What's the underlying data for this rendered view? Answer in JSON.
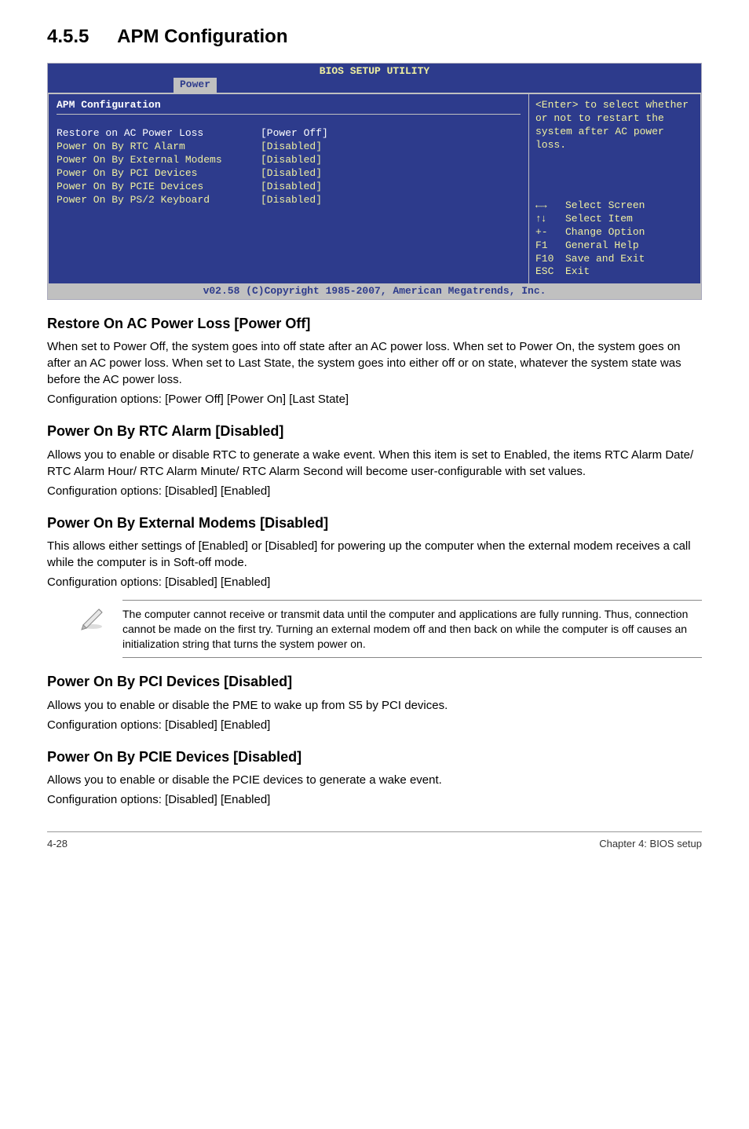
{
  "section": {
    "num": "4.5.5",
    "title": "APM Configuration"
  },
  "bios": {
    "title": "BIOS SETUP UTILITY",
    "tab": "Power",
    "left_header": "APM Configuration",
    "rows": [
      {
        "label": "Restore on AC Power Loss",
        "val": "[Power Off]",
        "selected": true
      },
      {
        "label": "Power On By RTC Alarm",
        "val": "[Disabled]",
        "selected": false
      },
      {
        "label": "Power On By External Modems",
        "val": "[Disabled]",
        "selected": false
      },
      {
        "label": "Power On By PCI Devices",
        "val": "[Disabled]",
        "selected": false
      },
      {
        "label": "Power On By PCIE Devices",
        "val": "[Disabled]",
        "selected": false
      },
      {
        "label": "Power On By PS/2 Keyboard",
        "val": "[Disabled]",
        "selected": false
      }
    ],
    "help_top": "<Enter> to select whether or not to restart the system after AC power loss.",
    "keys": [
      {
        "k": "←→",
        "d": "Select Screen"
      },
      {
        "k": "↑↓",
        "d": "Select Item"
      },
      {
        "k": "+-",
        "d": "Change Option"
      },
      {
        "k": "F1",
        "d": "General Help"
      },
      {
        "k": "F10",
        "d": "Save and Exit"
      },
      {
        "k": "ESC",
        "d": "Exit"
      }
    ],
    "footer": "v02.58 (C)Copyright 1985-2007, American Megatrends, Inc."
  },
  "sections": {
    "restore": {
      "h": "Restore On AC Power Loss [Power Off]",
      "p1": "When set to Power Off, the system goes into off state after an AC power loss. When set to Power On, the system goes on after an AC power loss. When set to Last State, the system goes into either off or on state, whatever the system state was before the AC power loss.",
      "p2": "Configuration options: [Power Off] [Power On] [Last State]"
    },
    "rtc": {
      "h": "Power On By RTC Alarm [Disabled]",
      "p1": "Allows you to enable or disable RTC to generate a wake event. When this item is set to Enabled, the items RTC Alarm Date/ RTC Alarm Hour/ RTC Alarm Minute/ RTC Alarm Second will become user-configurable with set values.",
      "p2": "Configuration options: [Disabled] [Enabled]"
    },
    "ext": {
      "h": "Power On By External Modems [Disabled]",
      "p1": "This allows either settings of [Enabled] or [Disabled] for powering up the computer when the external modem receives a call while the computer is in Soft-off mode.",
      "p2": "Configuration options: [Disabled] [Enabled]"
    },
    "note": "The computer cannot receive or transmit data until the computer and applications are fully running. Thus, connection cannot be made on the first try. Turning an external modem off and then back on while the computer is off causes an initialization string that turns the system power on.",
    "pci": {
      "h": "Power On By PCI Devices [Disabled]",
      "p1": "Allows you to enable or disable the PME to wake up from S5 by PCI devices.",
      "p2": "Configuration options: [Disabled] [Enabled]"
    },
    "pcie": {
      "h": "Power On By PCIE Devices [Disabled]",
      "p1": "Allows you to enable or disable the PCIE devices to generate a wake event.",
      "p2": "Configuration options: [Disabled] [Enabled]"
    }
  },
  "footer": {
    "left": "4-28",
    "right": "Chapter 4: BIOS setup"
  }
}
